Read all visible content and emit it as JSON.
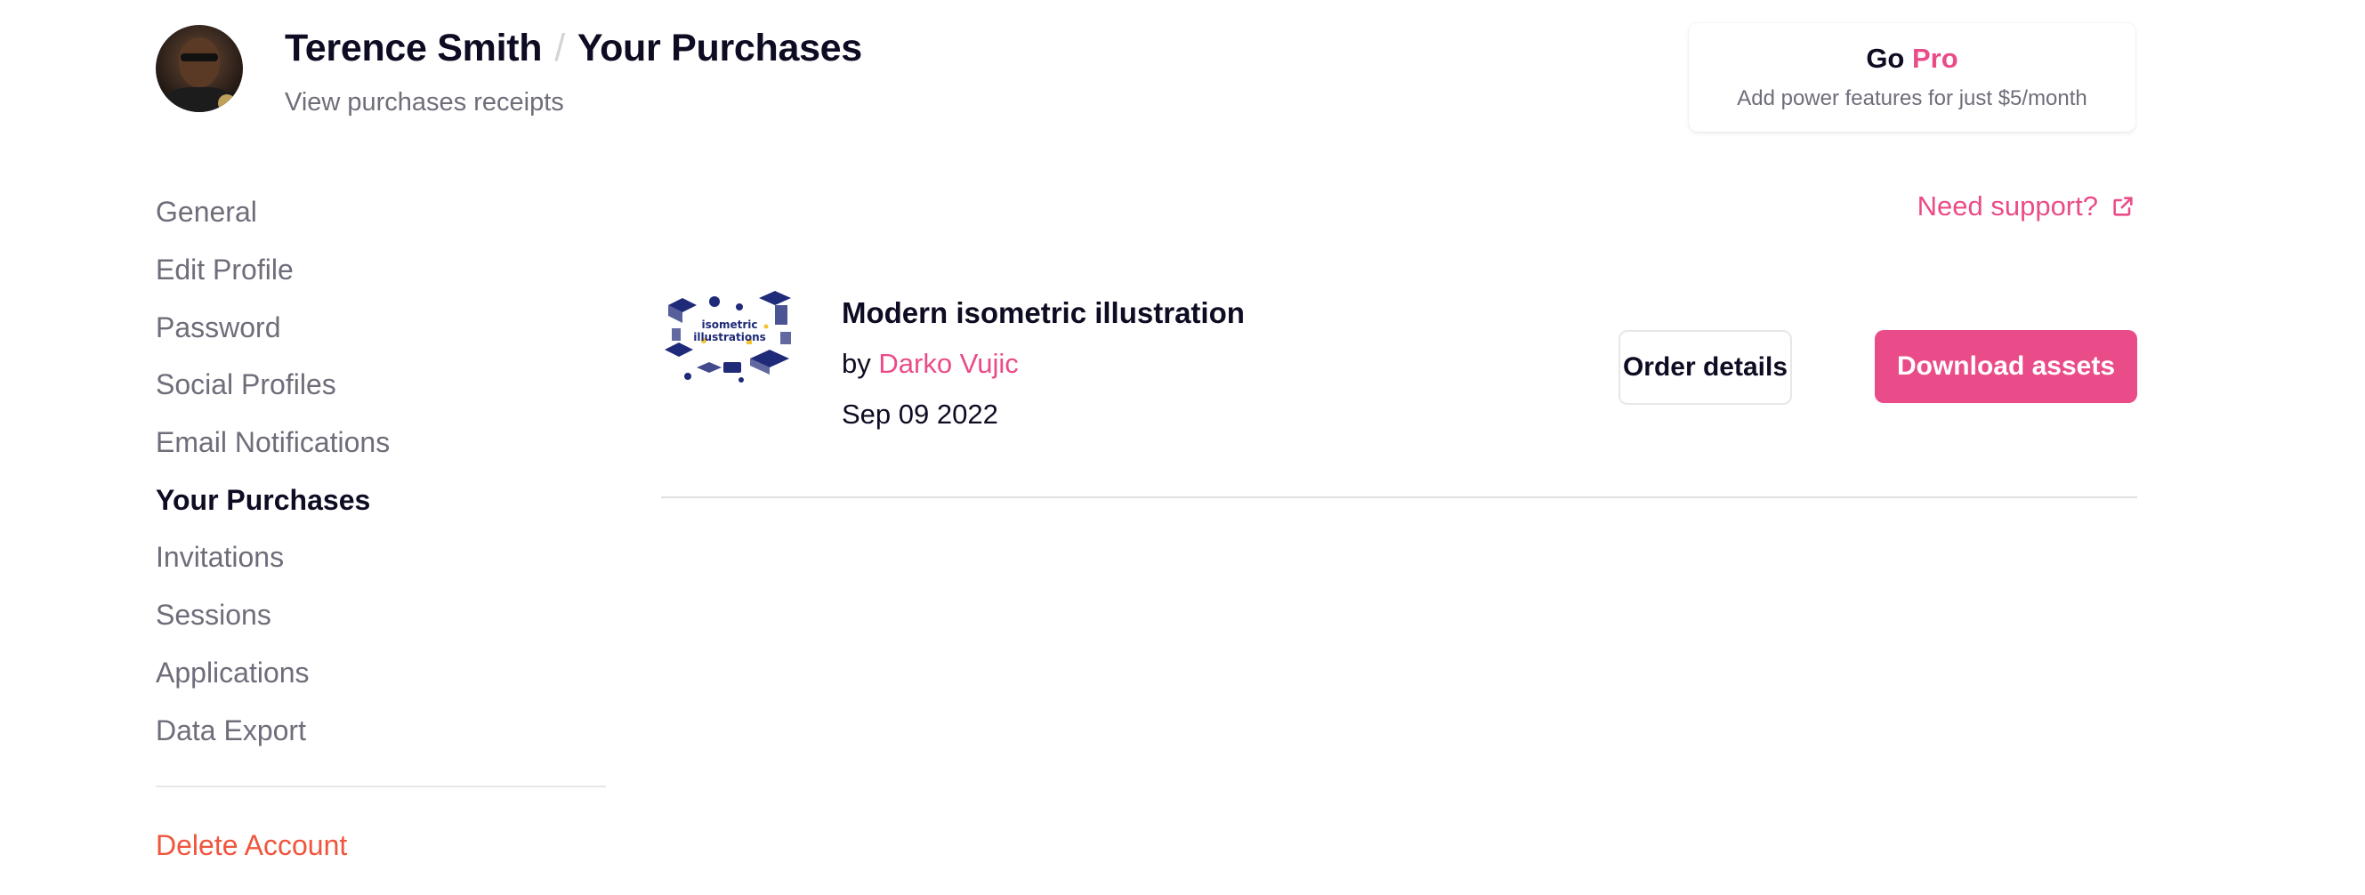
{
  "header": {
    "user_name": "Terence Smith",
    "separator": "/",
    "page_name": "Your Purchases",
    "subtitle": "View purchases receipts"
  },
  "pro_card": {
    "go_label": "Go",
    "pro_label": "Pro",
    "description": "Add power features for just $5/month"
  },
  "sidebar": {
    "items": [
      {
        "label": "General"
      },
      {
        "label": "Edit Profile"
      },
      {
        "label": "Password"
      },
      {
        "label": "Social Profiles"
      },
      {
        "label": "Email Notifications"
      },
      {
        "label": "Your Purchases",
        "active": true
      },
      {
        "label": "Invitations"
      },
      {
        "label": "Sessions"
      },
      {
        "label": "Applications"
      },
      {
        "label": "Data Export"
      }
    ],
    "delete_label": "Delete Account"
  },
  "support": {
    "label": "Need support?",
    "icon": "external-link-icon"
  },
  "purchases": [
    {
      "title": "Modern isometric illustration",
      "by_prefix": "by",
      "author": "Darko Vujic",
      "date": "Sep 09 2022",
      "thumbnail_text": "isometric illustrations",
      "order_details_label": "Order details",
      "download_label": "Download assets"
    }
  ],
  "colors": {
    "accent": "#ea4c89",
    "danger": "#f0553e",
    "muted": "#6e6d7a",
    "text": "#0d0c22",
    "illustration": "#1f2a78"
  }
}
